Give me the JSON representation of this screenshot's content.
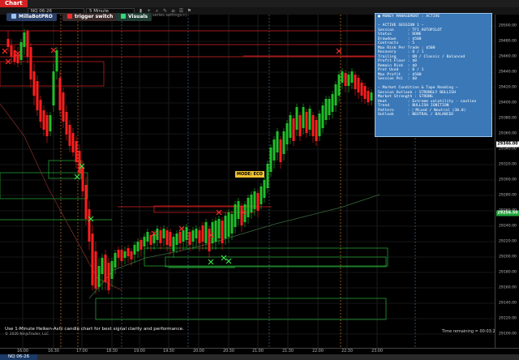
{
  "window": {
    "tab_label": "Chart"
  },
  "toolbar": {
    "instrument": "NQ 06-26",
    "interval": "5 Minute"
  },
  "buttons": {
    "brand": "MillaBotPRO",
    "trigger": "trigger switch",
    "visuals": "Visuals"
  },
  "hint": "series settings>)",
  "mode_label": "MODE: ECO",
  "panel": {
    "lines": [
      "■ MONEY MANAGEMENT : ACTIVE",
      "",
      "— ACTIVE SESSION 1 —",
      "Session      : TF1 AUTOPILOT",
      "Status       : DONE",
      "Drawdown     : $500",
      "Contracts    : 5",
      "Max Risk Per Trade : $500",
      "Recovery     : 0 / 1",
      "Trailing     : ON / Classic / Balanced",
      "Profit Floor : $0",
      "Remain Risk  : $0",
      "Prot Used    : 0 / 1",
      "Max Profit   : $500",
      "Session Pnl  : $0",
      "",
      "— Market Condition & Tape Reading —",
      "Session Outlook : STRONGLY BULLISH",
      "Market Strength : STRONG",
      "Heat         : Extreme volatility - caution",
      "Trend        : BULLISH IGNITION",
      "Pattern      : 🕯 Mixed / Neutral (30.0)",
      "Outlook      : NEUTRAL / BALANCED"
    ]
  },
  "note": "Use 1-Minute Heiken-Ashi candle chart for best signal clarity and performance.",
  "copyright": "© 2026 NinjaTrader, LLC",
  "time_remaining": "Time remaining = 00:03:24",
  "bottom_tab": "NQ 06-26",
  "y_labels": [
    "29500.00",
    "29480.00",
    "29460.00",
    "29440.00",
    "29420.00",
    "29400.00",
    "29380.00",
    "29360.00",
    "29340.00",
    "29320.00",
    "29300.00",
    "29280.00",
    "29260.00",
    "29240.00",
    "29220.00",
    "29200.00",
    "29180.00",
    "29160.00",
    "29140.00",
    "29120.00",
    "29100.00"
  ],
  "price_tags": [
    {
      "label": "29346.00",
      "price": 29346.0,
      "bg": "#ffffff",
      "color": "#000000"
    },
    {
      "label": "29256.50",
      "price": 29256.5,
      "bg": "#1fa33a",
      "color": "#ffffff"
    }
  ],
  "x_labels": [
    "16:00",
    "16:30",
    "17:00",
    "18:30",
    "19:00",
    "19:30",
    "20:00",
    "20:30",
    "21:00",
    "21:30",
    "22:00",
    "22:30",
    "23:00"
  ],
  "colors": {
    "bull": "#1fbf2a",
    "bear": "#ff1e1e",
    "accent": "#3a78b8",
    "mode": "#f1c232"
  },
  "icons": [
    "chart-tab-icon",
    "bars-icon",
    "crosshair-icon",
    "zoom-icon",
    "pencil-icon",
    "properties-icon",
    "list-icon",
    "alert-icon"
  ]
}
